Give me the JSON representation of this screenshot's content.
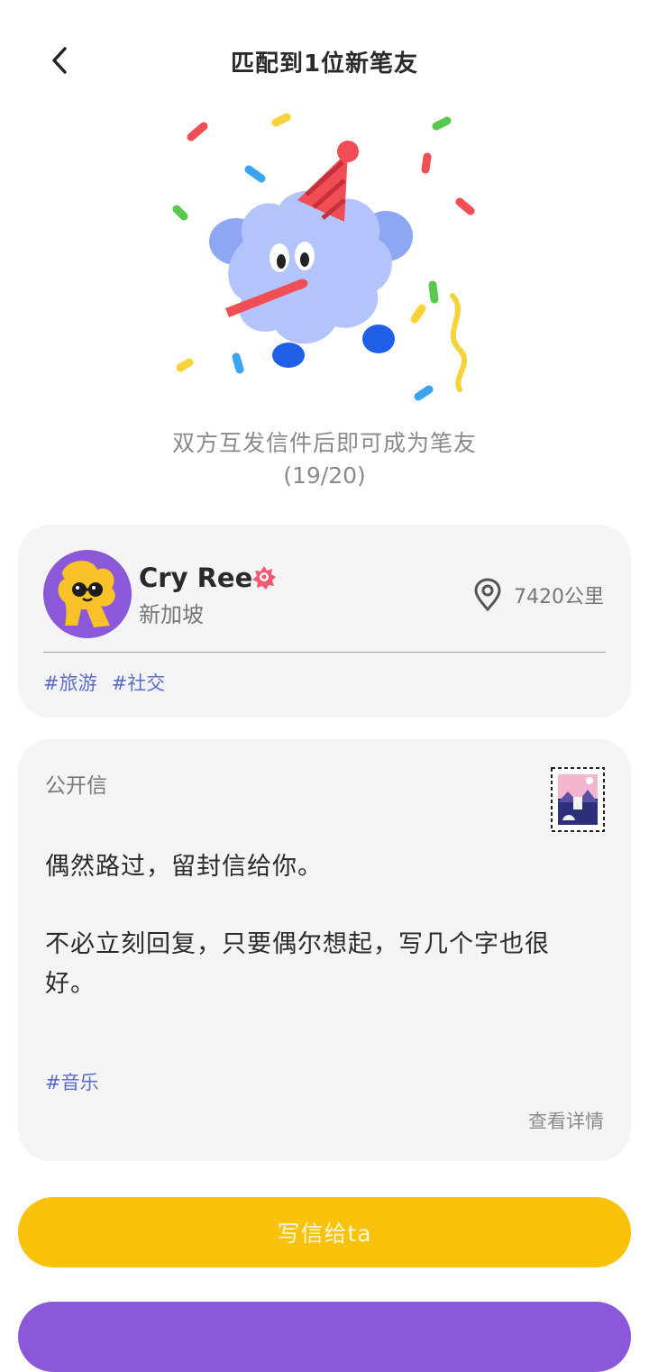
{
  "header": {
    "title": "匹配到1位新笔友",
    "back_icon": "chevron-left-icon"
  },
  "intro": {
    "message": "双方互发信件后即可成为笔友",
    "count": "(19/20)"
  },
  "profile": {
    "name": "Cry Ree",
    "city": "新加坡",
    "distance": "7420公里",
    "tags": [
      "#旅游",
      "#社交"
    ],
    "avatar_color": "#8a58d8"
  },
  "letter": {
    "label": "公开信",
    "paragraphs": [
      "偶然路过，留封信给你。",
      "不必立刻回复，只要偶尔想起，写几个字也很好。"
    ],
    "tag": "#音乐",
    "detail_link": "查看详情"
  },
  "buttons": {
    "write": "写信给ta",
    "write_color": "#f9c20a",
    "second_color": "#8a58d8"
  },
  "colors": {
    "card_bg": "#f4f4f6",
    "tag_color": "#5a6cc8"
  }
}
